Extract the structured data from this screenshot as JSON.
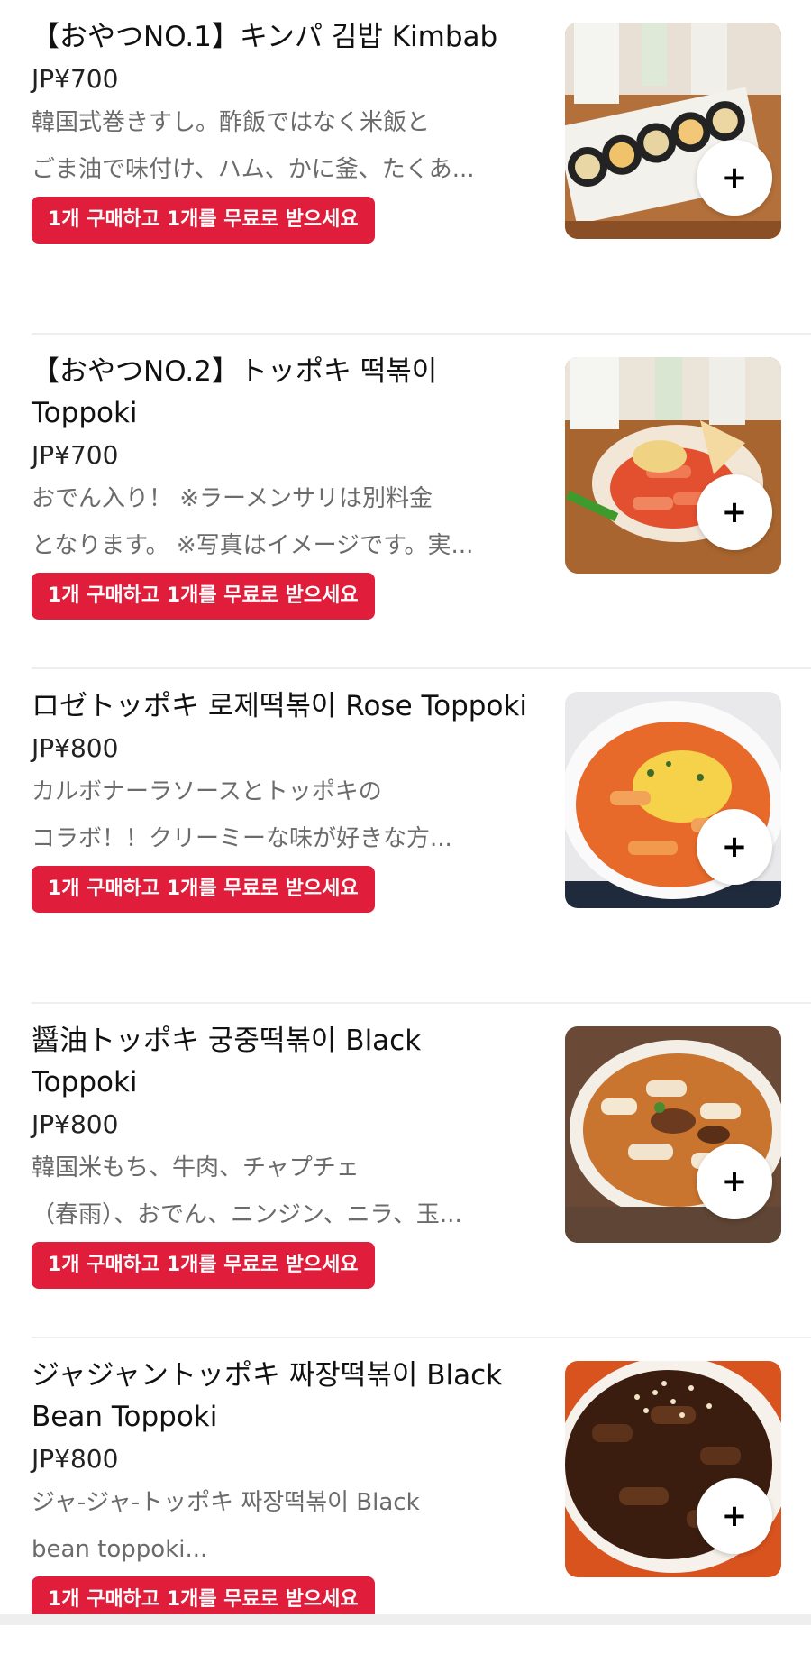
{
  "items": [
    {
      "title": "【おやつNO.1】キンパ 김밥 Kimbab",
      "price": "JP¥700",
      "desc_line1": "韓国式巻きすし。酢飯ではなく米飯と",
      "desc_line2": "ごま油で味付け、ハム、かに釜、たくあ...",
      "promo": "1개 구매하고 1개를 무료로 받으세요",
      "add_label": "+"
    },
    {
      "title": "【おやつNO.2】トッポキ 떡볶이 Toppoki",
      "price": "JP¥700",
      "desc_line1": "おでん入り！ ※ラーメンサリは別料金",
      "desc_line2": "となります。 ※写真はイメージです。実...",
      "promo": "1개 구매하고 1개를 무료로 받으세요",
      "add_label": "+"
    },
    {
      "title": "ロゼトッポキ 로제떡볶이 Rose Toppoki",
      "price": "JP¥800",
      "desc_line1": "カルボナーラソースとトッポキの",
      "desc_line2": "コラボ！！クリーミーな味が好きな方...",
      "promo": "1개 구매하고 1개를 무료로 받으세요",
      "add_label": "+"
    },
    {
      "title": "醤油トッポキ 궁중떡볶이 Black Toppoki",
      "price": "JP¥800",
      "desc_line1": "韓国米もち、牛肉、チャプチェ",
      "desc_line2": "（春雨）、おでん、ニンジン、ニラ、玉...",
      "promo": "1개 구매하고 1개를 무료로 받으세요",
      "add_label": "+"
    },
    {
      "title": "ジャジャントッポキ 짜장떡볶이 Black Bean Toppoki",
      "price": "JP¥800",
      "desc_line1": "ジャ-ジャ-トッポキ 짜장떡볶이 Black",
      "desc_line2": "bean toppoki...",
      "promo": "1개 구매하고 1개를 무료로 받으세요",
      "add_label": "+"
    }
  ],
  "colors": {
    "promo_bg": "#e01e3c",
    "promo_text": "#ffffff",
    "price_text": "#222222",
    "desc_text": "#6b6b6b",
    "divider": "#eeeeee"
  },
  "icons": {
    "add": "plus-icon"
  }
}
